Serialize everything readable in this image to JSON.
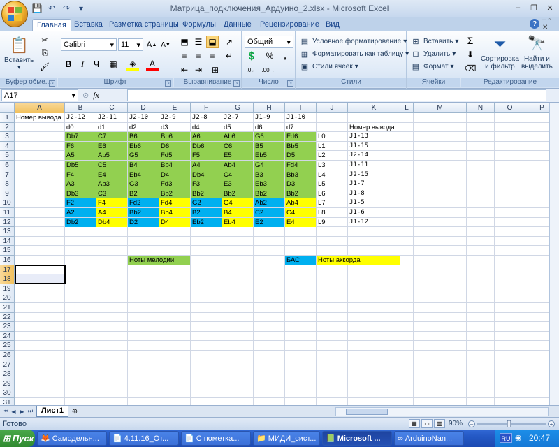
{
  "window": {
    "title": "Матрица_подключения_Ардуино_2.xlsx - Microsoft Excel",
    "controls": [
      "–",
      "❐",
      "✕"
    ]
  },
  "ribbon_tabs": [
    "Главная",
    "Вставка",
    "Разметка страницы",
    "Формулы",
    "Данные",
    "Рецензирование",
    "Вид"
  ],
  "ribbon": {
    "clipboard": {
      "paste": "Вставить",
      "label": "Буфер обме..."
    },
    "font": {
      "name": "Calibri",
      "size": "11",
      "label": "Шрифт"
    },
    "alignment": {
      "label": "Выравнивание"
    },
    "number": {
      "format": "Общий",
      "percent": "%",
      "comma": ",",
      "label": "Число"
    },
    "styles": {
      "conditional": "Условное форматирование",
      "as_table": "Форматировать как таблицу",
      "cell_styles": "Стили ячеек",
      "label": "Стили"
    },
    "cells": {
      "insert": "Вставить",
      "delete": "Удалить",
      "format": "Формат",
      "label": "Ячейки"
    },
    "editing": {
      "sum": "Σ",
      "sort1": "Сортировка",
      "sort2": "и фильтр",
      "find1": "Найти и",
      "find2": "выделить",
      "label": "Редактирование"
    }
  },
  "formula_bar": {
    "name_box": "A17",
    "fx": "fx",
    "formula": ""
  },
  "columns": [
    "A",
    "B",
    "C",
    "D",
    "E",
    "F",
    "G",
    "H",
    "I",
    "J",
    "K",
    "L",
    "M",
    "N",
    "O",
    "P"
  ],
  "rows": [
    "1",
    "2",
    "3",
    "4",
    "5",
    "6",
    "7",
    "8",
    "9",
    "10",
    "11",
    "12",
    "13",
    "14",
    "15",
    "16",
    "17",
    "18",
    "19",
    "20",
    "21",
    "22",
    "23",
    "24",
    "25",
    "26",
    "27",
    "28",
    "29",
    "30",
    "31"
  ],
  "sheet": {
    "row1": {
      "A": "Номер вывода",
      "B": "J2-12",
      "C": "J2-11",
      "D": "J2-10",
      "E": "J2-9",
      "F": "J2-8",
      "G": "J2-7",
      "H": "J1-9",
      "I": "J1-10"
    },
    "row2": {
      "B": "d0",
      "C": "d1",
      "D": "d2",
      "E": "d3",
      "F": "d4",
      "G": "d5",
      "H": "d6",
      "I": "d7",
      "K": "Номер вывода"
    },
    "notes": [
      [
        "Db7",
        "C7",
        "B6",
        "Bb6",
        "A6",
        "Ab6",
        "G6",
        "Fd6"
      ],
      [
        "F6",
        "E6",
        "Eb6",
        "D6",
        "Db6",
        "C6",
        "B5",
        "Bb5"
      ],
      [
        "A5",
        "Ab5",
        "G5",
        "Fd5",
        "F5",
        "E5",
        "Eb5",
        "D5"
      ],
      [
        "Db5",
        "C5",
        "B4",
        "Bb4",
        "A4",
        "Ab4",
        "G4",
        "Fd4"
      ],
      [
        "F4",
        "E4",
        "Eb4",
        "D4",
        "Db4",
        "C4",
        "B3",
        "Bb3"
      ],
      [
        "A3",
        "Ab3",
        "G3",
        "Fd3",
        "F3",
        "E3",
        "Eb3",
        "D3"
      ],
      [
        "Db3",
        "C3",
        "B2",
        "Bb2",
        "Bb2",
        "Bb2",
        "Bb2",
        "Bb2"
      ],
      [
        "F2",
        "F4",
        "Fd2",
        "Fd4",
        "G2",
        "G4",
        "Ab2",
        "Ab4"
      ],
      [
        "A2",
        "A4",
        "Bb2",
        "Bb4",
        "B2",
        "B4",
        "C2",
        "C4"
      ],
      [
        "Db2",
        "Db4",
        "D2",
        "D4",
        "Eb2",
        "Eb4",
        "E2",
        "E4"
      ]
    ],
    "colJ": [
      "L0",
      "L1",
      "L2",
      "L3",
      "L4",
      "L5",
      "L6",
      "L7",
      "L8",
      "L9"
    ],
    "colK": [
      "J1-13",
      "J1-15",
      "J2-14",
      "J1-11",
      "J2-15",
      "J1-7",
      "J1-8",
      "J1-5",
      "J1-6",
      "J1-12"
    ],
    "legend": {
      "melody": "Ноты мелодии",
      "bass": "БАС",
      "chord": "Ноты аккорда"
    },
    "colors": {
      "green": "#92d050",
      "blue": "#00b0f0",
      "yellow": "#ffff00"
    }
  },
  "sheet_tabs": {
    "active": "Лист1"
  },
  "status": {
    "text": "Готово",
    "zoom": "90%"
  },
  "taskbar": {
    "start": "Пуск",
    "items": [
      "Самодельн...",
      "4.11.16_От...",
      "С пометка...",
      "МИДИ_сист...",
      "Microsoft ...",
      "ArduinoNan..."
    ],
    "lang": "RU",
    "clock": "20:47"
  }
}
